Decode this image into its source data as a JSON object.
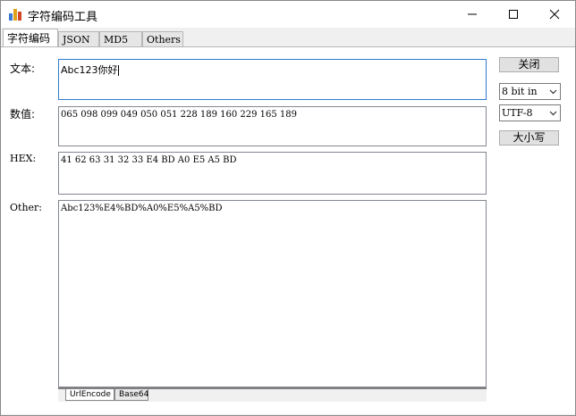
{
  "window": {
    "title": "字符编码工具",
    "icon": "bar-chart-icon",
    "controls": [
      "minimize-icon",
      "maximize-icon",
      "close-icon"
    ]
  },
  "tabs": [
    {
      "label": "字符编码",
      "active": true
    },
    {
      "label": "JSON",
      "active": false
    },
    {
      "label": "MD5",
      "active": false
    },
    {
      "label": "Others",
      "active": false
    }
  ],
  "fields": {
    "text": {
      "label": "文本:",
      "value": "Abc123你好"
    },
    "numeric": {
      "label": "数值:",
      "value": "065 098 099 049 050 051 228 189 160 229 165 189"
    },
    "hex": {
      "label": "HEX:",
      "value": "41 62 63 31 32 33 E4 BD A0 E5 A5 BD"
    },
    "other": {
      "label": "Other:",
      "value": "Abc123%E4%BD%A0%E5%A5%BD"
    }
  },
  "side": {
    "close_button": "关闭",
    "bit_select": "8 bit in",
    "encoding_select": "UTF-8",
    "case_button": "大小写"
  },
  "subtabs": [
    {
      "label": "UrlEncode",
      "active": true
    },
    {
      "label": "Base64",
      "active": false
    }
  ],
  "colors": {
    "focus_border": "#2f7ccf",
    "titlebar": "#ffffff",
    "window_bg": "#f0f0f0"
  }
}
